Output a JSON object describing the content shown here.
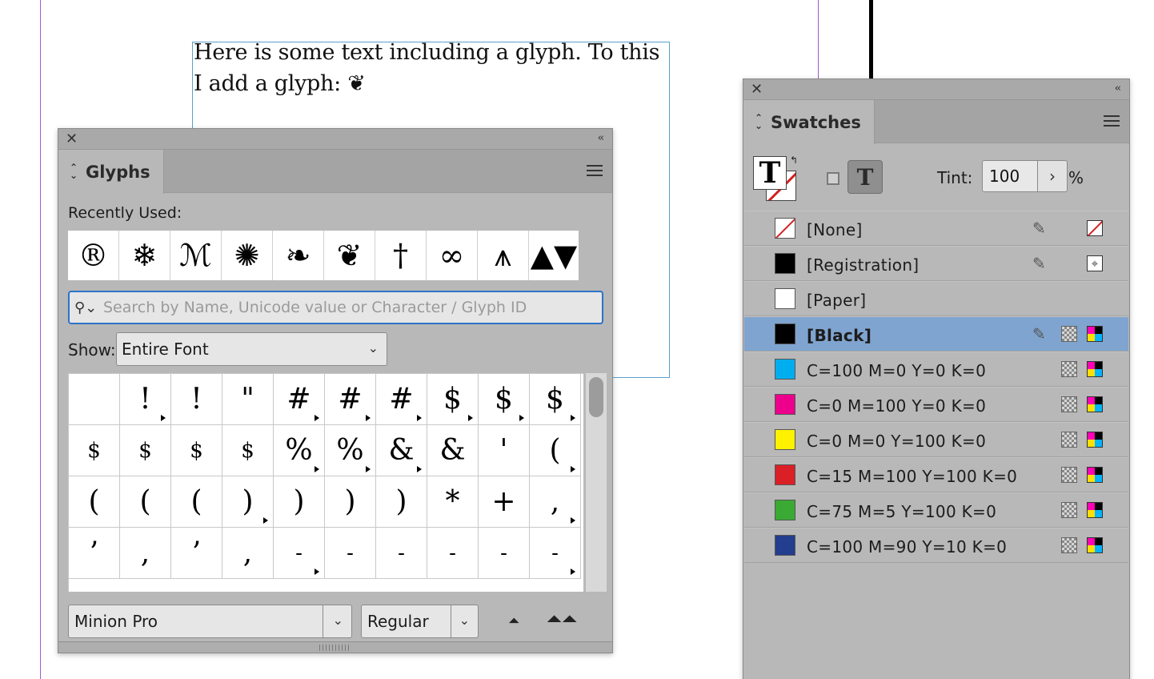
{
  "document": {
    "text": "Here is some text including a glyph. To this I add a glyph: ❦"
  },
  "glyphs_panel": {
    "tab_label": "Glyphs",
    "recently_used_label": "Recently Used:",
    "recently_used": [
      "®",
      "❄",
      "ℳ",
      "✺",
      "❧",
      "❦",
      "†",
      "∞",
      "⩚",
      "▲▼"
    ],
    "search_placeholder": "Search by Name, Unicode value or Character / Glyph ID",
    "show_label": "Show:",
    "show_value": "Entire Font",
    "grid_rows": [
      [
        "",
        "!",
        "!",
        "\"",
        "#",
        "#",
        "#",
        "$",
        "$",
        "$"
      ],
      [
        "$",
        "$",
        "$",
        "$",
        "%",
        "%",
        "&",
        "&",
        "'",
        "("
      ],
      [
        "(",
        "(",
        "(",
        ")",
        ")",
        ")",
        ")",
        "*",
        "+",
        ","
      ],
      [
        "’",
        ",",
        "’",
        ",",
        "-",
        "-",
        "-",
        "-",
        "-",
        "-"
      ]
    ],
    "font_family": "Minion Pro",
    "font_style": "Regular"
  },
  "swatches_panel": {
    "tab_label": "Swatches",
    "tint_label": "Tint:",
    "tint_value": "100",
    "tint_unit": "%",
    "swatches": [
      {
        "name": "[None]",
        "color": "none"
      },
      {
        "name": "[Registration]",
        "color": "#000000"
      },
      {
        "name": "[Paper]",
        "color": "#ffffff"
      },
      {
        "name": "[Black]",
        "color": "#000000",
        "selected": true
      },
      {
        "name": "C=100 M=0 Y=0 K=0",
        "color": "#00aeef"
      },
      {
        "name": "C=0 M=100 Y=0 K=0",
        "color": "#ec008c"
      },
      {
        "name": "C=0 M=0 Y=100 K=0",
        "color": "#fff200"
      },
      {
        "name": "C=15 M=100 Y=100 K=0",
        "color": "#da1f26"
      },
      {
        "name": "C=75 M=5 Y=100 K=0",
        "color": "#3aaa35"
      },
      {
        "name": "C=100 M=90 Y=10 K=0",
        "color": "#233d8f"
      }
    ]
  }
}
